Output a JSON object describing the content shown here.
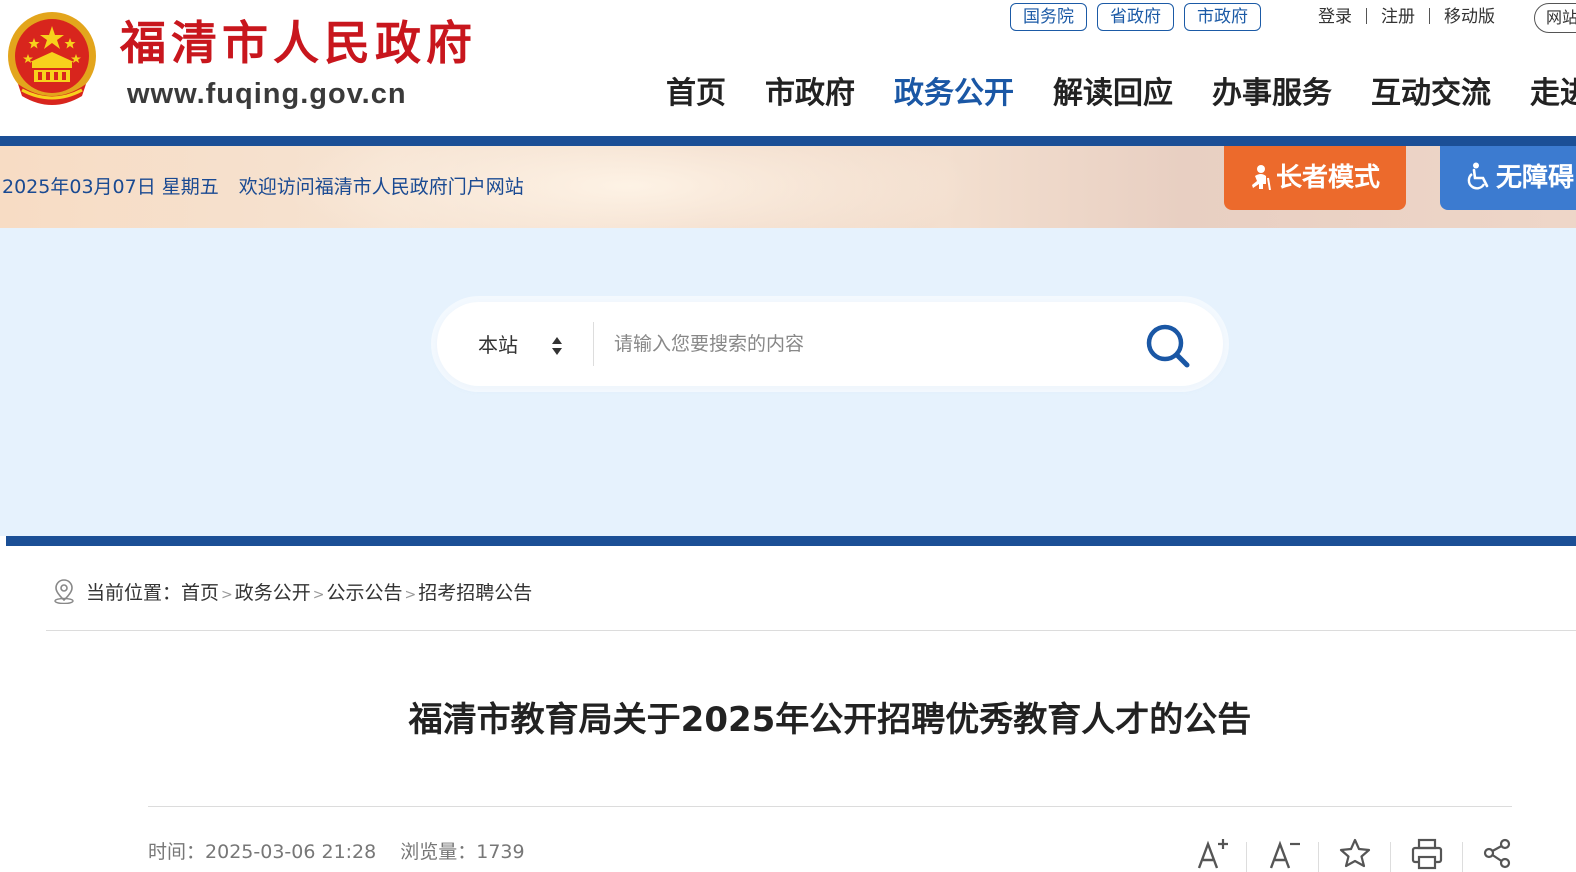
{
  "header": {
    "site_name": "福清市人民政府",
    "site_url": "www.fuqing.gov.cn",
    "gov_links": [
      "国务院",
      "省政府",
      "市政府"
    ],
    "user_links": {
      "login": "登录",
      "register": "注册",
      "mobile": "移动版"
    },
    "net_pill": "网站",
    "nav": [
      "首页",
      "市政府",
      "政务公开",
      "解读回应",
      "办事服务",
      "互动交流",
      "走进福清"
    ],
    "active_nav": "政务公开",
    "colors": {
      "brand_red": "#c8161d",
      "brand_blue": "#1b4f96",
      "active_nav": "#1a57a5"
    }
  },
  "banner": {
    "date": "2025年03月07日 星期五",
    "welcome": "欢迎访问福清市人民政府门户网站",
    "elder_mode": "长者模式",
    "accessibility": "无障碍",
    "colors": {
      "elder": "#ec6a2c",
      "accessibility": "#3c7bd0"
    }
  },
  "search": {
    "scope": "本站",
    "placeholder": "请输入您要搜索的内容",
    "value": ""
  },
  "breadcrumb": {
    "label": "当前位置：",
    "items": [
      "首页",
      "政务公开",
      "公示公告",
      "招考招聘公告"
    ]
  },
  "article": {
    "title": "福清市教育局关于2025年公开招聘优秀教育人才的公告",
    "time_label": "时间：",
    "time": "2025-03-06 21:28",
    "views_label": "浏览量：",
    "views": "1739"
  },
  "tools": [
    "font-increase-icon",
    "font-decrease-icon",
    "star-icon",
    "print-icon",
    "share-icon"
  ]
}
